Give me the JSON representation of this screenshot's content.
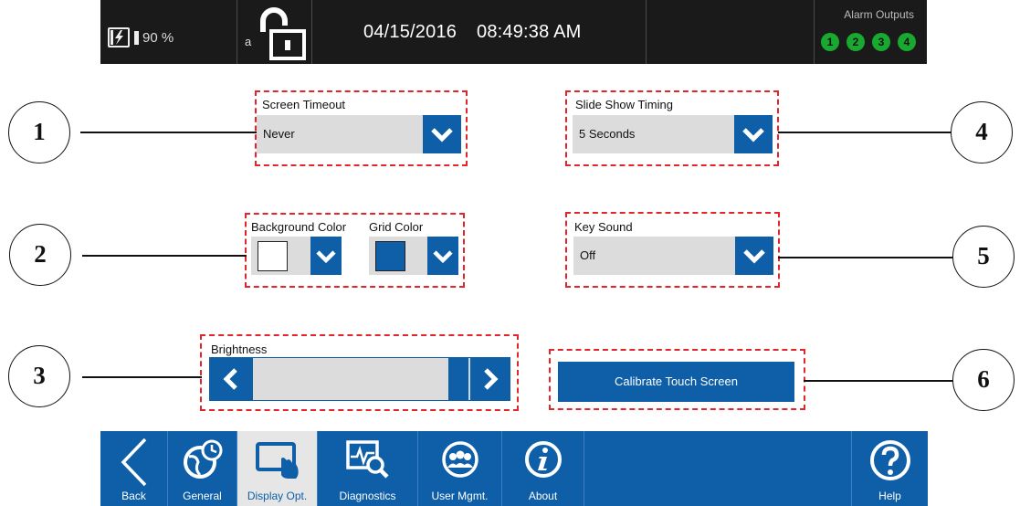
{
  "status_bar": {
    "battery_percent": "90 %",
    "lock_prefix": "a",
    "date": "04/15/2016",
    "time": "08:49:38 AM",
    "alarm_outputs_title": "Alarm Outputs",
    "alarm_outputs": [
      "1",
      "2",
      "3",
      "4"
    ],
    "alarm_color": "#19a830"
  },
  "settings": {
    "screen_timeout": {
      "label": "Screen Timeout",
      "value": "Never"
    },
    "slide_show_timing": {
      "label": "Slide Show Timing",
      "value": "5 Seconds"
    },
    "background_color": {
      "label": "Background Color",
      "value": "#ffffff"
    },
    "grid_color": {
      "label": "Grid Color",
      "value": "#0e5fa8"
    },
    "key_sound": {
      "label": "Key Sound",
      "value": "Off"
    },
    "brightness": {
      "label": "Brightness"
    },
    "calibrate_label": "Calibrate Touch Screen"
  },
  "callouts": [
    "1",
    "2",
    "3",
    "4",
    "5",
    "6"
  ],
  "nav": {
    "back": "Back",
    "general": "General",
    "display": "Display Opt.",
    "diagnostics": "Diagnostics",
    "user_mgmt": "User Mgmt.",
    "about": "About",
    "help": "Help",
    "active_tab": "Display Opt."
  },
  "colors": {
    "accent": "#0e5fa8",
    "highlight": "#e0262b",
    "field": "#dcdcdc",
    "statusbar": "#1a1a1a"
  }
}
